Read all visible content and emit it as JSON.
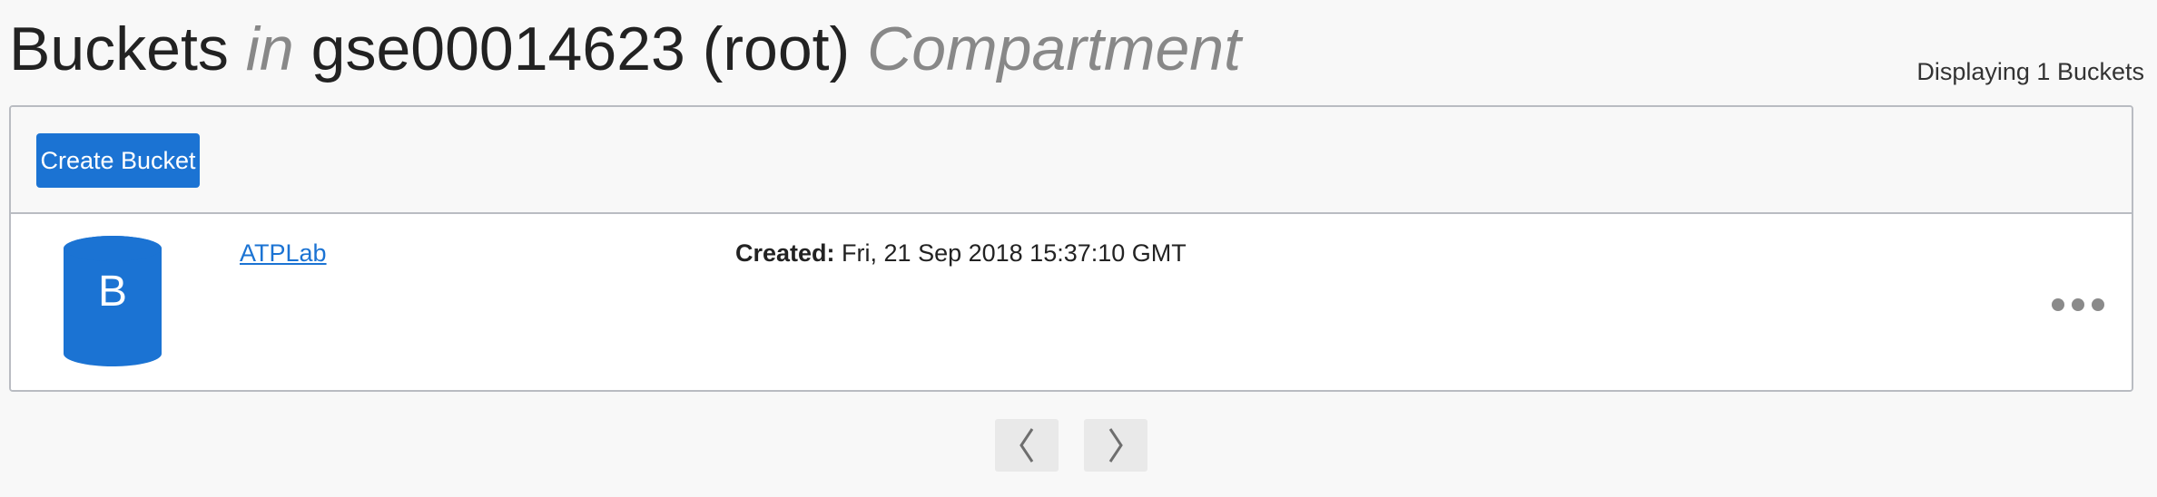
{
  "header": {
    "title_prefix": "Buckets",
    "title_in": "in",
    "compartment_name": "gse00014623 (root)",
    "title_suffix": "Compartment",
    "display_count": "Displaying 1 Buckets"
  },
  "toolbar": {
    "create_label": "Create Bucket"
  },
  "buckets": [
    {
      "icon_letter": "B",
      "name": "ATPLab",
      "created_label": "Created:",
      "created_value": "Fri, 21 Sep 2018 15:37:10 GMT",
      "more_icon": "ellipsis-icon"
    }
  ],
  "pagination": {
    "prev_icon": "chevron-left-icon",
    "next_icon": "chevron-right-icon"
  },
  "colors": {
    "accent": "#1b73d3",
    "border": "#b9bcc2",
    "background": "#f8f8f8"
  }
}
